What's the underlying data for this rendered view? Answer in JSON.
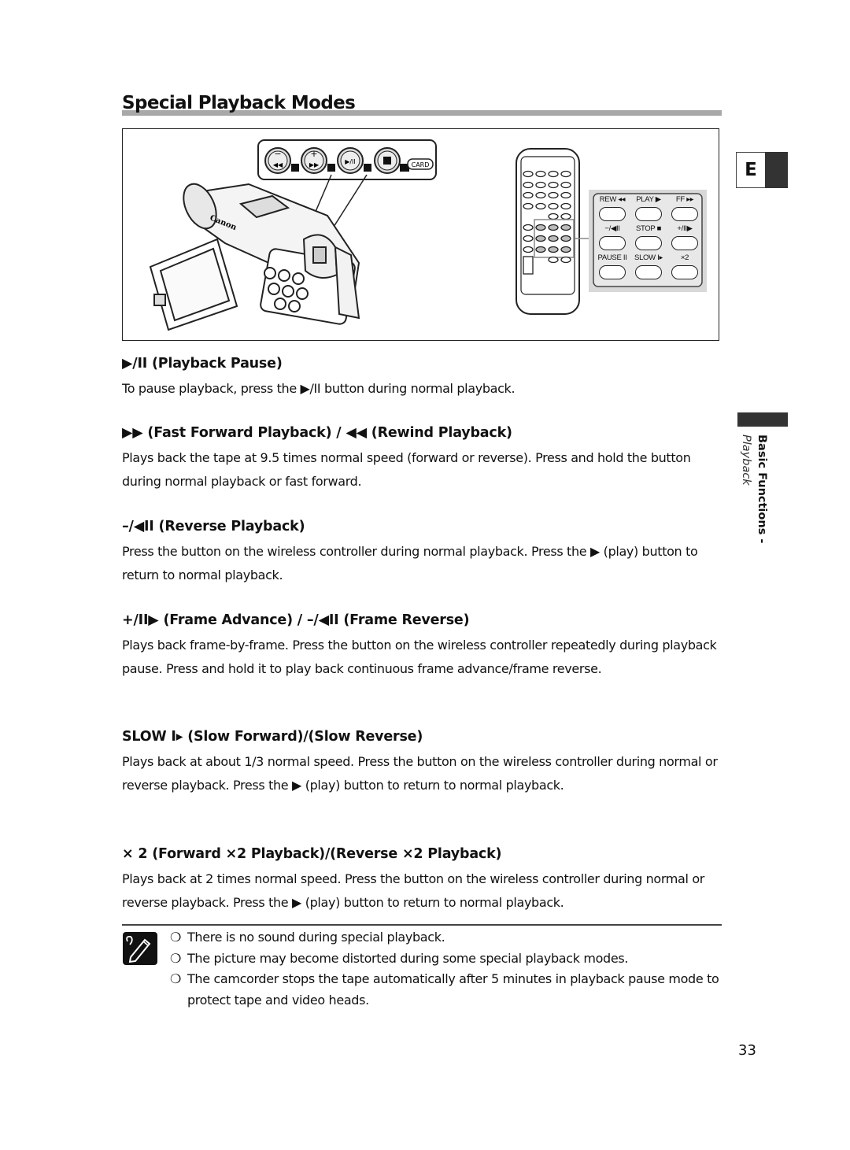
{
  "page": {
    "title": "Special Playback Modes",
    "language_tab": "E",
    "side_label_bold": "Basic Functions -",
    "side_label_italic": "Playback",
    "page_number": "33"
  },
  "figure": {
    "camcorder_brand": "Canon",
    "camcorder_buttons": [
      {
        "top": "−",
        "icon": "◀◀",
        "name": "rewind"
      },
      {
        "top": "+",
        "icon": "▶▶",
        "name": "fast-forward"
      },
      {
        "top": "",
        "icon": "▶/II",
        "name": "play-pause"
      },
      {
        "top": "",
        "icon": "■",
        "name": "stop"
      }
    ],
    "card_label": "CARD",
    "remote_buttons": [
      {
        "label": "REW ◂◂",
        "name": "rew"
      },
      {
        "label": "PLAY ▶",
        "name": "play"
      },
      {
        "label": "FF ▸▸",
        "name": "ff"
      },
      {
        "label": "−/◀II",
        "name": "reverse"
      },
      {
        "label": "STOP ■",
        "name": "stop"
      },
      {
        "label": "+/II▶",
        "name": "frame-advance"
      },
      {
        "label": "PAUSE II",
        "name": "pause"
      },
      {
        "label": "SLOW I▸",
        "name": "slow"
      },
      {
        "label": "×2",
        "name": "x2"
      }
    ]
  },
  "sections": [
    {
      "heading_symbol": "▶/II",
      "heading_text": " (Playback Pause)",
      "body": "To pause playback, press the ▶/II button during normal playback."
    },
    {
      "heading_symbol": "▶▶",
      "heading_text": " (Fast Forward Playback) / ◀◀ (Rewind Playback)",
      "body": "Plays back the tape at 9.5 times normal speed (forward or reverse). Press and hold the button during normal playback or fast forward."
    },
    {
      "heading_symbol": "–/◀II",
      "heading_text": " (Reverse Playback)",
      "body": "Press the button on the wireless controller during normal playback. Press the ▶ (play) button to return to normal playback."
    },
    {
      "heading_symbol": "+/II▶",
      "heading_text": " (Frame Advance) / –/◀II (Frame Reverse)",
      "body": "Plays back frame-by-frame. Press the button on the wireless controller repeatedly during playback pause. Press and hold it to play back continuous frame advance/frame reverse."
    },
    {
      "heading_symbol": "SLOW I▸",
      "heading_text": " (Slow Forward)/(Slow Reverse)",
      "body": "Plays back at about 1/3 normal speed. Press the button on the wireless controller during normal or reverse playback. Press the ▶ (play) button to return to normal playback."
    },
    {
      "heading_symbol": "× 2",
      "heading_text": " (Forward ×2 Playback)/(Reverse ×2 Playback)",
      "body": "Plays back at 2 times normal speed. Press the button on the wireless controller during normal or reverse playback. Press the ▶ (play) button to return to normal playback."
    }
  ],
  "notes": {
    "bullet": "❍",
    "items": [
      "There is no sound during special playback.",
      "The picture may become distorted during some special playback modes.",
      "The camcorder stops the tape automatically after 5 minutes in playback pause mode to protect tape and video heads."
    ]
  }
}
